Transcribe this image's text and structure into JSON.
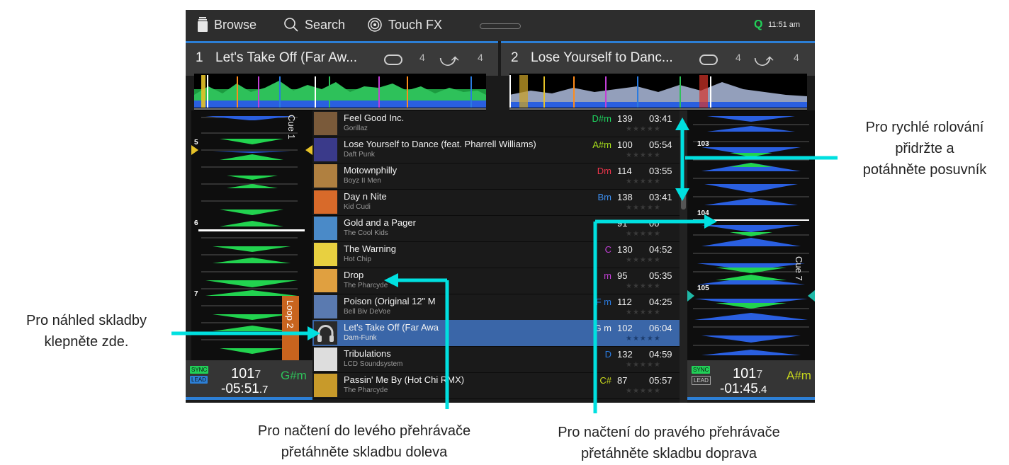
{
  "topbar": {
    "browse_label": "Browse",
    "search_label": "Search",
    "touchfx_label": "Touch FX",
    "quantize_label": "Q",
    "clock": "11:51 am"
  },
  "deck1": {
    "number": "1",
    "title": "Let's Take Off (Far Aw...",
    "loop_count": "4",
    "jump_count": "4",
    "cue_label": "Cue 1",
    "loop_label": "Loop 2",
    "beat_markers": [
      "5",
      "6",
      "7"
    ],
    "sync_label": "SYNC",
    "lead_label": "LEAD",
    "bpm_int": "101",
    "bpm_dec": "7",
    "key": "G#m",
    "remaining": "-05:51",
    "remaining_dec": ".7"
  },
  "deck2": {
    "number": "2",
    "title": "Lose Yourself to Danc...",
    "loop_count": "4",
    "jump_count": "4",
    "cue_label": "Cue 7",
    "beat_markers": [
      "103",
      "104",
      "105"
    ],
    "sync_label": "SYNC",
    "lead_label": "LEAD",
    "bpm_int": "101",
    "bpm_dec": "7",
    "key": "A#m",
    "remaining": "-01:45",
    "remaining_dec": ".4"
  },
  "tracks": [
    {
      "title": "Feel Good Inc.",
      "artist": "Gorillaz",
      "key": "D#m",
      "key_color": "#1ed760",
      "bpm": "139",
      "time": "03:41"
    },
    {
      "title": "Lose Yourself to Dance (feat. Pharrell Williams)",
      "artist": "Daft Punk",
      "key": "A#m",
      "key_color": "#a8e01c",
      "bpm": "100",
      "time": "05:54"
    },
    {
      "title": "Motownphilly",
      "artist": "Boyz II Men",
      "key": "Dm",
      "key_color": "#e8344a",
      "bpm": "114",
      "time": "03:55"
    },
    {
      "title": "Day n Nite",
      "artist": "Kid Cudi",
      "key": "Bm",
      "key_color": "#3d8ff0",
      "bpm": "138",
      "time": "03:41"
    },
    {
      "title": "Gold and a Pager",
      "artist": "The Cool Kids",
      "key": "",
      "key_color": "#e0e0e0",
      "bpm": "91",
      "time": "00"
    },
    {
      "title": "The Warning",
      "artist": "Hot Chip",
      "key": "C",
      "key_color": "#c23fd6",
      "bpm": "130",
      "time": "04:52"
    },
    {
      "title": "Drop",
      "artist": "The Pharcyde",
      "key": "m",
      "key_color": "#c23fd6",
      "bpm": "95",
      "time": "05:35"
    },
    {
      "title": "Poison (Original 12\" M",
      "artist": "Bell Biv DeVoe",
      "key": "F m",
      "key_color": "#2a7be0",
      "bpm": "112",
      "time": "04:25"
    },
    {
      "title": "Let's Take Off (Far Awa",
      "artist": "Dam-Funk",
      "key": "G m",
      "key_color": "#f0f0f0",
      "bpm": "102",
      "time": "06:04"
    },
    {
      "title": "Tribulations",
      "artist": "LCD Soundsystem",
      "key": "D",
      "key_color": "#2a7be0",
      "bpm": "132",
      "time": "04:59"
    },
    {
      "title": "Passin' Me By (Hot Chi RMX)",
      "artist": "The Pharcyde",
      "key": "C#",
      "key_color": "#c8d81c",
      "bpm": "87",
      "time": "05:57"
    }
  ],
  "annotations": {
    "scroll": [
      "Pro rychlé rolování",
      "přidržte a",
      "potáhněte posuvník"
    ],
    "preview": [
      "Pro náhled skladby",
      "klepněte zde."
    ],
    "load_left": [
      "Pro načtení do levého přehrávače",
      "přetáhněte skladbu doleva"
    ],
    "load_right": [
      "Pro načtení do pravého přehrávače",
      "přetáhněte skladbu doprava"
    ]
  },
  "colors": {
    "accent": "#2c7fd6",
    "selected_row": "#3a66a8",
    "arrow": "#00e0e0",
    "wave_green": "#22d34f",
    "wave_blue": "#2a5fe0",
    "loop_orange": "#c8641e"
  }
}
